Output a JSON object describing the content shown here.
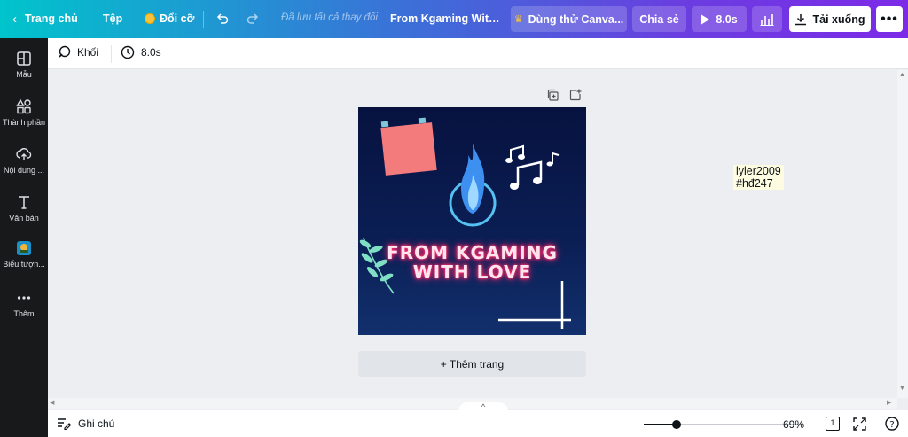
{
  "header": {
    "home": "Trang chủ",
    "file": "Tệp",
    "resize": "Đổi cỡ",
    "saved_status": "Đã lưu tất cả thay đổi",
    "doc_title": "From Kgaming With L...",
    "try_pro": "Dùng thử Canva...",
    "share": "Chia sẻ",
    "play_duration": "8.0s",
    "download": "Tải xuống"
  },
  "sidebar": {
    "items": [
      {
        "label": "Mẫu",
        "icon": "layout-icon"
      },
      {
        "label": "Thành phần",
        "icon": "elements-icon"
      },
      {
        "label": "Nội dung ...",
        "icon": "upload-icon"
      },
      {
        "label": "Văn bản",
        "icon": "text-icon"
      },
      {
        "label": "Biểu tượn...",
        "icon": "brand-icon"
      },
      {
        "label": "Thêm",
        "icon": "more-icon"
      }
    ]
  },
  "toolbar": {
    "shape_label": "Khối",
    "timing_label": "8.0s"
  },
  "design": {
    "line1": "FROM KGAMING",
    "line2": "WITH LOVE",
    "bg_color": "#0b1f55"
  },
  "canvas": {
    "add_page": "+ Thêm trang",
    "sticky_line1": "lyler2009",
    "sticky_line2": "#hđ247"
  },
  "bottom": {
    "notes": "Ghi chú",
    "zoom": "69%",
    "zoom_fraction": 0.69,
    "page_number": "1"
  }
}
